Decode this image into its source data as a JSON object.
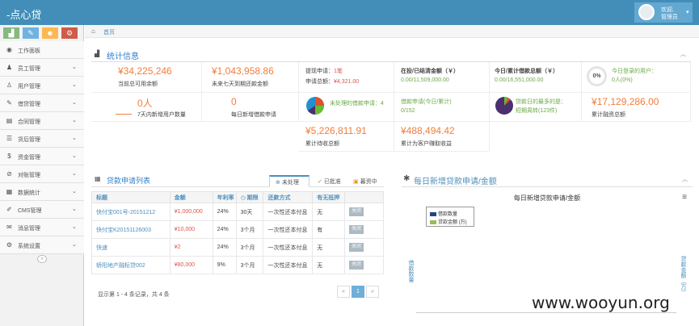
{
  "app": {
    "title": "-点心贷"
  },
  "user": {
    "welcome": "欢迎,",
    "name": "管理员"
  },
  "shortcut_colors": [
    "#87b87f",
    "#6fb3e0",
    "#ffb752",
    "#d15b47"
  ],
  "sidebar": {
    "items": [
      {
        "icon": "dashboard-icon",
        "label": "工作面板",
        "glyph": "◉",
        "arrow": false
      },
      {
        "icon": "users-icon",
        "label": "员工管理",
        "glyph": "♟",
        "arrow": true
      },
      {
        "icon": "user-icon",
        "label": "用户管理",
        "glyph": "♙",
        "arrow": true
      },
      {
        "icon": "edit-icon",
        "label": "借贷管理",
        "glyph": "✎",
        "arrow": true
      },
      {
        "icon": "file-icon",
        "label": "合同管理",
        "glyph": "▤",
        "arrow": true
      },
      {
        "icon": "list-icon",
        "label": "货后管理",
        "glyph": "☰",
        "arrow": true
      },
      {
        "icon": "dollar-icon",
        "label": "资金管理",
        "glyph": "$",
        "arrow": true
      },
      {
        "icon": "ban-icon",
        "label": "对账管理",
        "glyph": "⊘",
        "arrow": true
      },
      {
        "icon": "bar-chart-icon",
        "label": "数据统计",
        "glyph": "▦",
        "arrow": true
      },
      {
        "icon": "pencil-icon",
        "label": "CMS管理",
        "glyph": "✐",
        "arrow": true
      },
      {
        "icon": "mail-icon",
        "label": "消息管理",
        "glyph": "✉",
        "arrow": true
      },
      {
        "icon": "gears-icon",
        "label": "系统设置",
        "glyph": "⚙",
        "arrow": true
      }
    ],
    "collapse": "«"
  },
  "breadcrumb": {
    "home": "首页"
  },
  "stats": {
    "title": "统计信息",
    "available_balance": {
      "value": "¥34,225,246",
      "label": "当前总可用余额"
    },
    "unreturned": {
      "value": "¥1,043,958.86",
      "label": "未来七天到期还款金额"
    },
    "withdraw": {
      "label": "提现申请：",
      "count": "1笔",
      "total_label": "申请总额：",
      "total": "¥4,321.00"
    },
    "investing": {
      "label": "在投/已结清金额（￥）",
      "value": "0.00/11,509,000.00"
    },
    "today_loan": {
      "label": "今日/累计借款总额（￥）",
      "value": "0.00/16,551,000.00"
    },
    "login_users": {
      "percent": "0%",
      "label": "今日登录的用户：",
      "value": "0人(0%)"
    },
    "new_users": {
      "value": "0人",
      "label": "7天内新增用户数量"
    },
    "new_applications": {
      "value": "0",
      "label": "每日新增借款申请"
    },
    "unprocessed": {
      "label": "未处理的借款申请：4"
    },
    "applications": {
      "label": "借款申请(今日/累计)",
      "value": "0/152"
    },
    "most_loans": {
      "label": "贷款日的最多的是：",
      "value": "短期周转(123件)"
    },
    "total_financing": {
      "value": "¥17,129,286.00",
      "label": "累计融资总额"
    },
    "receivable": {
      "value": "¥5,226,811.91",
      "label": "累计待收总额"
    },
    "profit": {
      "value": "¥488,494.42",
      "label": "累计为客户赚取收益"
    }
  },
  "loans": {
    "title": "贷款申请列表",
    "tabs": [
      "未处理",
      "已批准",
      "暮资中"
    ],
    "columns": [
      "标题",
      "金额",
      "年利率",
      "期限",
      "还款方式",
      "有无抵押",
      ""
    ],
    "rows": [
      {
        "title": "快付宝001号-20151212",
        "amount": "¥1,000,000",
        "rate": "24%",
        "term": "30天",
        "method": "一次性还本付息",
        "mortgage": "无",
        "action": "关闭"
      },
      {
        "title": "快付宝K20151126003",
        "amount": "¥10,000",
        "rate": "24%",
        "term": "3个月",
        "method": "一次性还本付息",
        "mortgage": "有",
        "action": "关闭"
      },
      {
        "title": "快速",
        "amount": "¥2",
        "rate": "24%",
        "term": "3个月",
        "method": "一次性还本付息",
        "mortgage": "无",
        "action": "关闭"
      },
      {
        "title": "轿阳地产融标贷002",
        "amount": "¥80,000",
        "rate": "9%",
        "term": "3个月",
        "method": "一次性还本付息",
        "mortgage": "无",
        "action": "关闭"
      }
    ],
    "summary": "显示第 1 - 4 条记录，共 4 条",
    "pager": [
      "«",
      "1",
      "»"
    ]
  },
  "daily": {
    "title": "每日新增贷款申请/金额",
    "chart_title": "每日新增贷款申请/金额"
  },
  "chart_data": {
    "type": "bar",
    "title": "每日新增贷款申请/金额",
    "series": [
      {
        "name": "借款数量",
        "color": "#1f497d",
        "values": []
      },
      {
        "name": "贷款金额 (万)",
        "color": "#9bbb59",
        "values": []
      }
    ],
    "ylabel": "借款数量",
    "y2label": "贷款金额（万）",
    "legend": "top-left"
  },
  "watermark": "www.wooyun.org"
}
